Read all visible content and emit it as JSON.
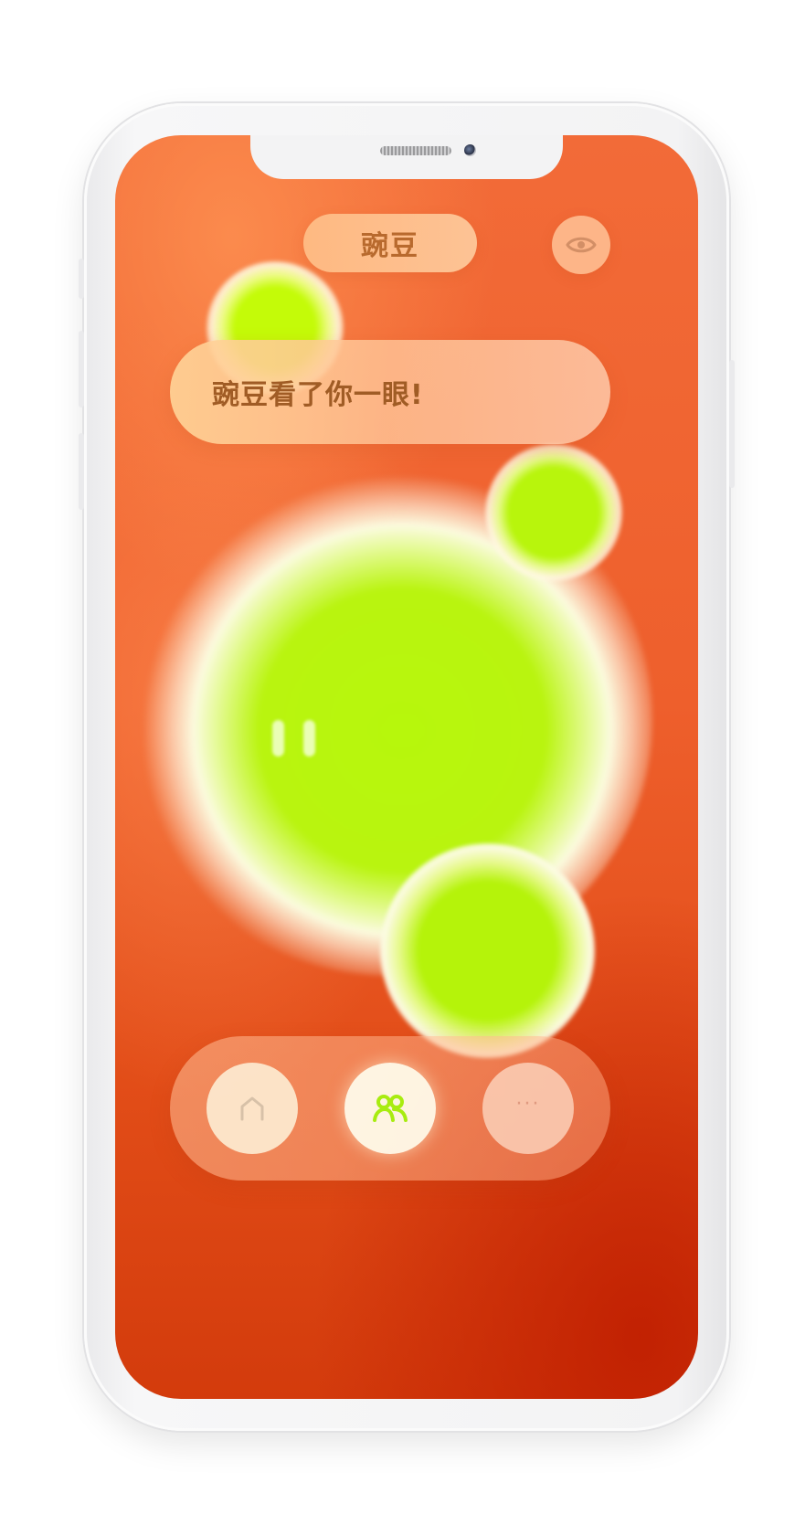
{
  "header": {
    "pet_name": "豌豆",
    "view_icon": "eye-icon"
  },
  "message": {
    "text": "豌豆看了你一眼!"
  },
  "nav": {
    "items": [
      {
        "id": "home",
        "icon": "home-icon"
      },
      {
        "id": "friends",
        "icon": "friends-icon",
        "active": true
      },
      {
        "id": "more",
        "icon": "more-icon",
        "label": "···"
      }
    ]
  },
  "colors": {
    "background": "#f26b38",
    "blob": "#b9f40f",
    "accent_text": "#a05c25",
    "friends_icon": "#a8ec10"
  }
}
